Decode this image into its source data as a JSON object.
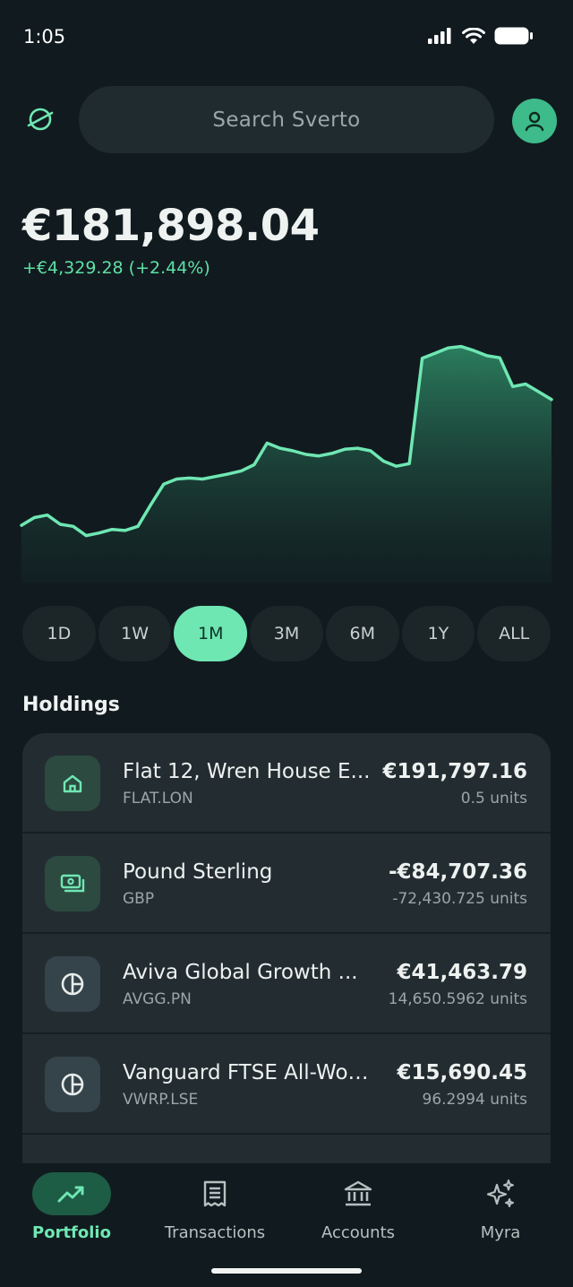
{
  "status": {
    "time": "1:05"
  },
  "search": {
    "placeholder": "Search Sverto"
  },
  "portfolio": {
    "balance": "€181,898.04",
    "change": "+€4,329.28 (+2.44%)"
  },
  "chart_data": {
    "type": "area",
    "title": "",
    "xlabel": "",
    "ylabel": "",
    "grid": false,
    "legend": "none",
    "line_color": "#6fe7b3",
    "values": [
      158000,
      159500,
      160000,
      158200,
      157800,
      156000,
      156500,
      157200,
      157000,
      157800,
      162000,
      166000,
      167000,
      167200,
      167000,
      167500,
      168000,
      168600,
      169800,
      174000,
      173000,
      172500,
      171800,
      171500,
      172000,
      172800,
      173000,
      172500,
      170500,
      169500,
      170000,
      190500,
      191500,
      192500,
      192800,
      192000,
      191000,
      190600,
      185000,
      185500,
      184000,
      182500
    ],
    "ylim": [
      150000,
      195000
    ]
  },
  "periods": [
    "1D",
    "1W",
    "1M",
    "3M",
    "6M",
    "1Y",
    "ALL"
  ],
  "active_period": "1M",
  "holdings_title": "Holdings",
  "holdings": [
    {
      "name": "Flat 12, Wren House E...",
      "ticker": "FLAT.LON",
      "value": "€191,797.16",
      "units": "0.5 units",
      "icon": "home-icon"
    },
    {
      "name": "Pound Sterling",
      "ticker": "GBP",
      "value": "-€84,707.36",
      "units": "-72,430.725 units",
      "icon": "cash-icon"
    },
    {
      "name": "Aviva Global Growth ...",
      "ticker": "AVGG.PN",
      "value": "€41,463.79",
      "units": "14,650.5962 units",
      "icon": "pie-chart-icon"
    },
    {
      "name": "Vanguard FTSE All-Worl...",
      "ticker": "VWRP.LSE",
      "value": "€15,690.45",
      "units": "96.2994 units",
      "icon": "pie-chart-icon"
    }
  ],
  "nav": [
    {
      "label": "Portfolio",
      "icon": "trend-icon",
      "active": true
    },
    {
      "label": "Transactions",
      "icon": "receipt-icon",
      "active": false
    },
    {
      "label": "Accounts",
      "icon": "bank-icon",
      "active": false
    },
    {
      "label": "Myra",
      "icon": "sparkle-icon",
      "active": false
    }
  ]
}
